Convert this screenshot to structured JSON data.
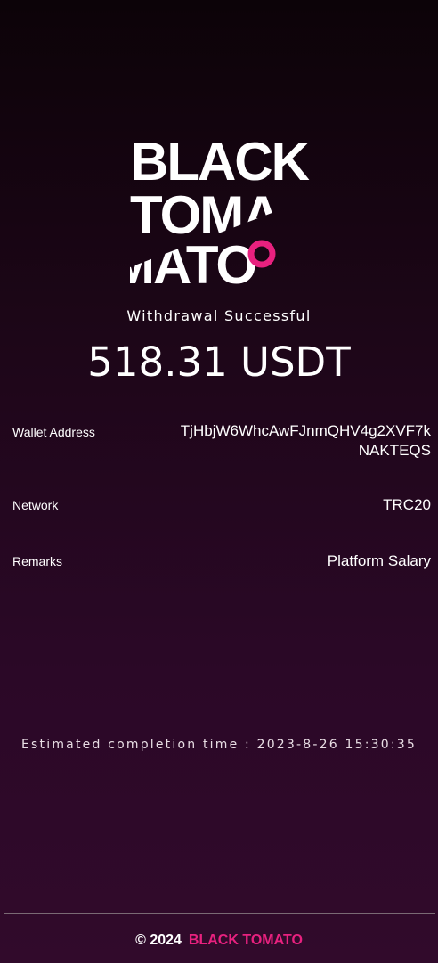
{
  "logo": {
    "line1": "BLACK",
    "line2": "TOMA",
    "line3": "MATO",
    "accent_color": "#e8217f"
  },
  "status": {
    "title": "Withdrawal Successful",
    "amount": "518.31 USDT"
  },
  "details": [
    {
      "label": "Wallet Address",
      "value": "TjHbjW6WhcAwFJnmQHV4g2XVF7kNAKTEQS"
    },
    {
      "label": "Network",
      "value": "TRC20"
    },
    {
      "label": "Remarks",
      "value": "Platform Salary"
    }
  ],
  "estimated": "Estimated completion time : 2023-8-26 15:30:35",
  "footer": {
    "copyright": "© 2024",
    "brand": "BLACK TOMATO"
  },
  "colors": {
    "accent": "#e8217f",
    "background_top": "#0c0308",
    "background_bottom": "#310a2b"
  }
}
